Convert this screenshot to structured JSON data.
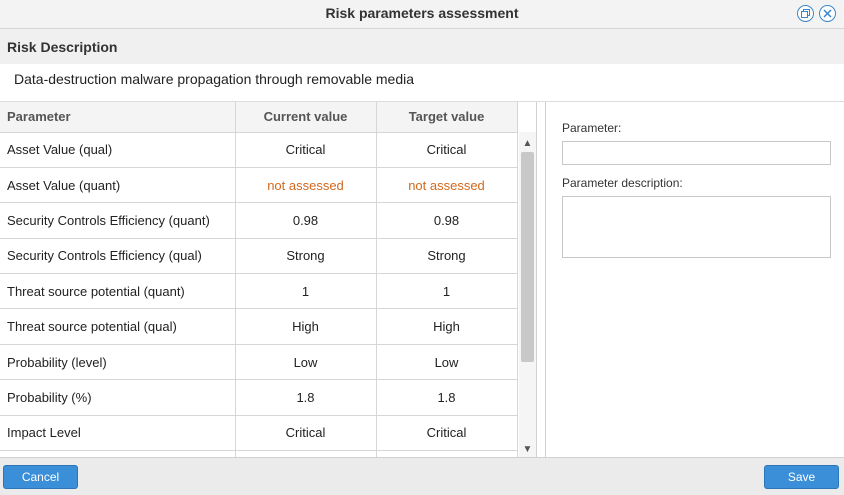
{
  "window": {
    "title": "Risk parameters assessment"
  },
  "risk": {
    "section_label": "Risk Description",
    "description": "Data-destruction malware propagation through removable media"
  },
  "table": {
    "headers": [
      "Parameter",
      "Current value",
      "Target value"
    ],
    "rows": [
      {
        "parameter": "Asset Value (qual)",
        "current": "Critical",
        "target": "Critical"
      },
      {
        "parameter": "Asset Value (quant)",
        "current": "not assessed",
        "target": "not assessed"
      },
      {
        "parameter": "Security Controls Efficiency (quant)",
        "current": "0.98",
        "target": "0.98"
      },
      {
        "parameter": "Security Controls Efficiency (qual)",
        "current": "Strong",
        "target": "Strong"
      },
      {
        "parameter": "Threat source potential (quant)",
        "current": "1",
        "target": "1"
      },
      {
        "parameter": "Threat source potential (qual)",
        "current": "High",
        "target": "High"
      },
      {
        "parameter": "Probability (level)",
        "current": "Low",
        "target": "Low"
      },
      {
        "parameter": "Probability (%)",
        "current": "1.8",
        "target": "1.8"
      },
      {
        "parameter": "Impact Level",
        "current": "Critical",
        "target": "Critical"
      }
    ]
  },
  "side_panel": {
    "parameter_label": "Parameter:",
    "parameter_value": "",
    "description_label": "Parameter description:",
    "description_value": ""
  },
  "footer": {
    "cancel_label": "Cancel",
    "save_label": "Save"
  },
  "colors": {
    "accent": "#3a8fd8",
    "warning_text": "#d2691e"
  }
}
